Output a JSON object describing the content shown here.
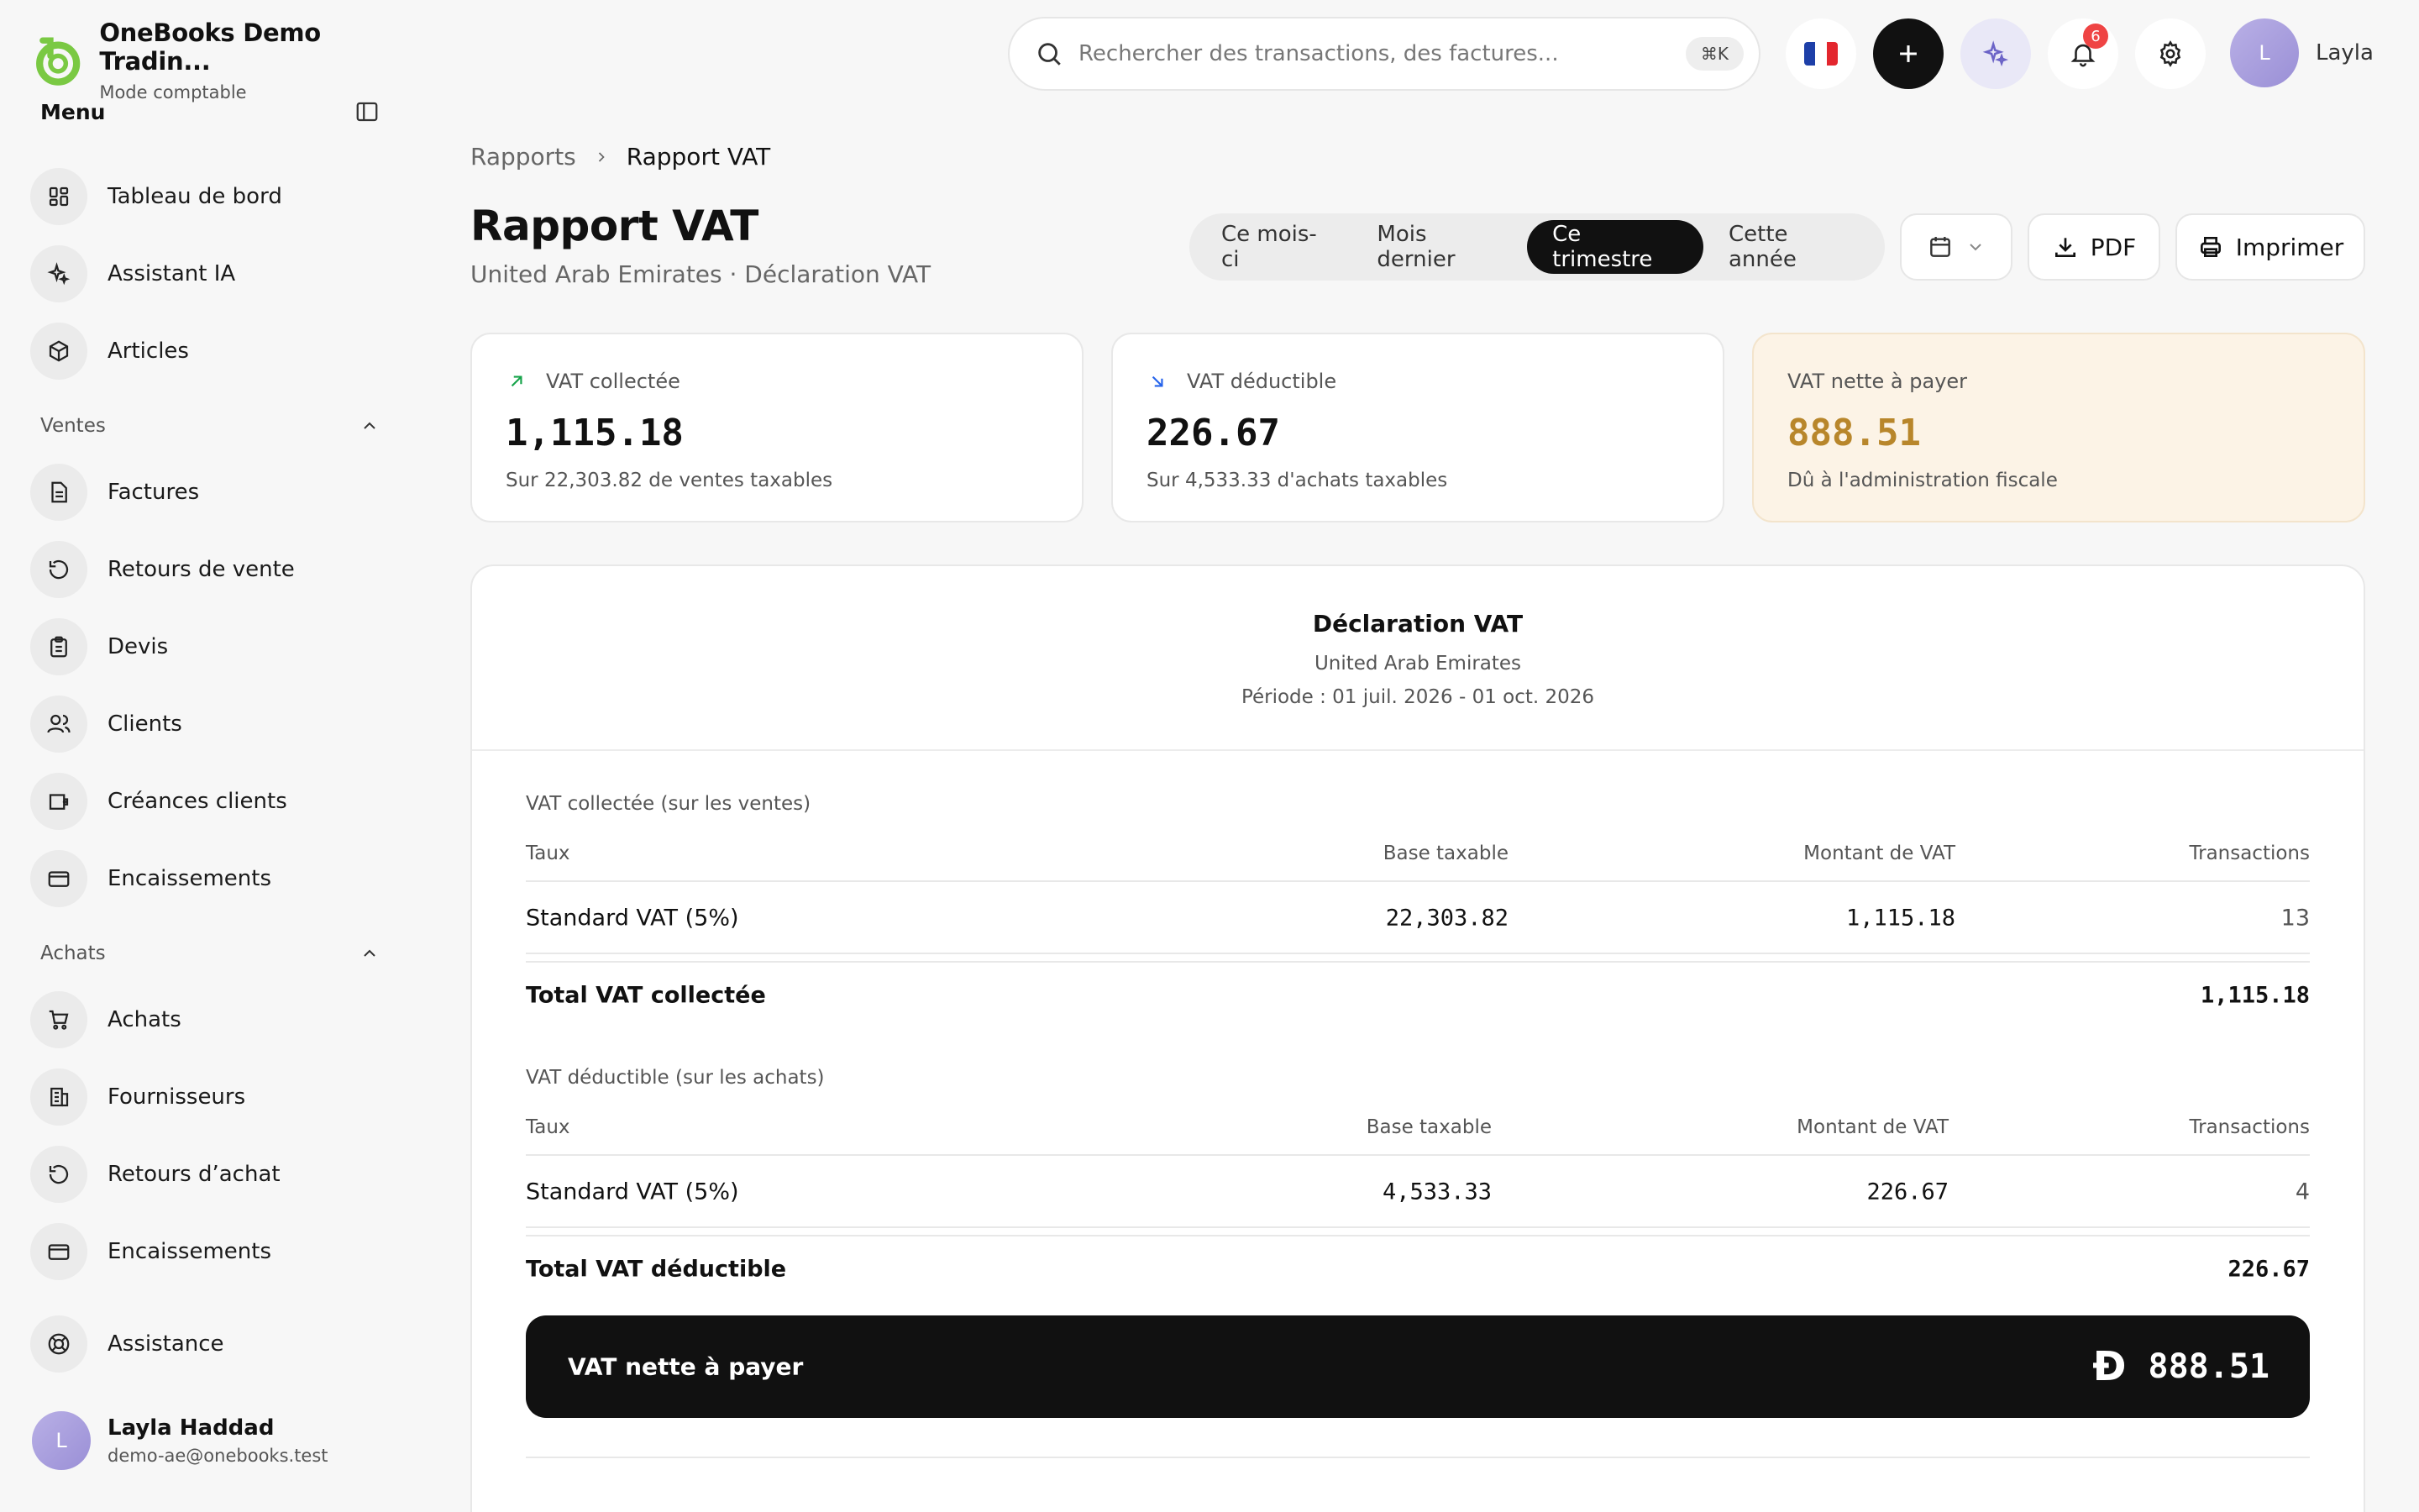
{
  "brand": {
    "name": "OneBooks Demo Tradin...",
    "subtitle": "Mode comptable"
  },
  "sidebar": {
    "menu_title": "Menu",
    "top_items": [
      {
        "label": "Tableau de bord",
        "icon": "dashboard-icon"
      },
      {
        "label": "Assistant IA",
        "icon": "sparkle-icon"
      },
      {
        "label": "Articles",
        "icon": "box-icon"
      }
    ],
    "sales_section": "Ventes",
    "sales_items": [
      {
        "label": "Factures",
        "icon": "document-icon"
      },
      {
        "label": "Retours de vente",
        "icon": "undo-icon"
      },
      {
        "label": "Devis",
        "icon": "clipboard-icon"
      },
      {
        "label": "Clients",
        "icon": "users-icon"
      },
      {
        "label": "Créances clients",
        "icon": "wallet-icon"
      },
      {
        "label": "Encaissements",
        "icon": "card-icon"
      }
    ],
    "purchases_section": "Achats",
    "purchase_items": [
      {
        "label": "Achats",
        "icon": "cart-icon"
      },
      {
        "label": "Fournisseurs",
        "icon": "building-icon"
      },
      {
        "label": "Retours d’achat",
        "icon": "undo-icon"
      },
      {
        "label": "Encaissements",
        "icon": "card-icon"
      }
    ],
    "support": {
      "label": "Assistance",
      "icon": "lifebuoy-icon"
    },
    "user": {
      "initial": "L",
      "name": "Layla Haddad",
      "email": "demo-ae@onebooks.test"
    }
  },
  "header": {
    "search_placeholder": "Rechercher des transactions, des factures...",
    "shortcut": "⌘K",
    "notification_count": "6",
    "user_initial": "L",
    "user_name": "Layla"
  },
  "breadcrumb": {
    "parent": "Rapports",
    "current": "Rapport VAT"
  },
  "page": {
    "title": "Rapport VAT",
    "subtitle": "United Arab Emirates · Déclaration VAT"
  },
  "periods": {
    "this_month": "Ce mois-ci",
    "last_month": "Mois dernier",
    "this_quarter": "Ce trimestre",
    "this_year": "Cette année",
    "active": "Ce trimestre"
  },
  "actions": {
    "pdf": "PDF",
    "print": "Imprimer"
  },
  "cards": {
    "collected": {
      "label": "VAT collectée",
      "value": "1,115.18",
      "note": "Sur 22,303.82 de ventes taxables"
    },
    "deductible": {
      "label": "VAT déductible",
      "value": "226.67",
      "note": "Sur 4,533.33 d'achats taxables"
    },
    "net": {
      "label": "VAT nette à payer",
      "value": "888.51",
      "note": "Dû à l'administration fiscale"
    }
  },
  "report": {
    "title": "Déclaration VAT",
    "country": "United Arab Emirates",
    "period": "Période : 01 juil. 2026 - 01 oct. 2026",
    "collected_section": {
      "caption": "VAT collectée (sur les ventes)",
      "headers": {
        "rate": "Taux",
        "base": "Base taxable",
        "vat": "Montant de VAT",
        "tx": "Transactions"
      },
      "row": {
        "rate": "Standard VAT (5%)",
        "base": "22,303.82",
        "vat": "1,115.18",
        "tx": "13"
      },
      "total_label": "Total VAT collectée",
      "total_value": "1,115.18"
    },
    "deductible_section": {
      "caption": "VAT déductible (sur les achats)",
      "headers": {
        "rate": "Taux",
        "base": "Base taxable",
        "vat": "Montant de VAT",
        "tx": "Transactions"
      },
      "row": {
        "rate": "Standard VAT (5%)",
        "base": "4,533.33",
        "vat": "226.67",
        "tx": "4"
      },
      "total_label": "Total VAT déductible",
      "total_value": "226.67"
    },
    "net": {
      "label": "VAT nette à payer",
      "currency_symbol": "Đ",
      "value": "888.51"
    }
  },
  "colors": {
    "accent_green": "#7ac943",
    "amber_card": "#fcf3e6",
    "amber_value": "#b8862b",
    "badge_red": "#ef4444"
  }
}
